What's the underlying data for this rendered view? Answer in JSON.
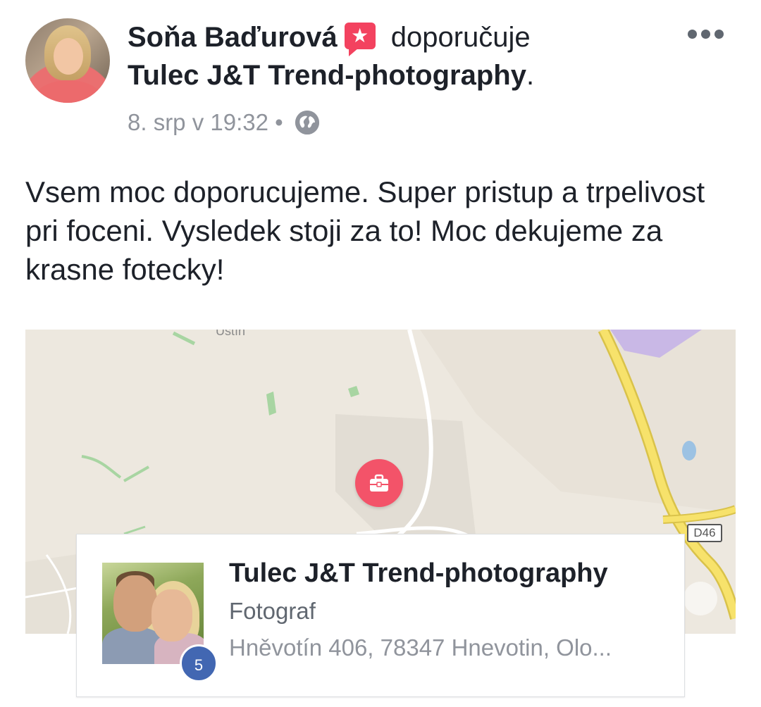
{
  "post": {
    "author": "Soňa Baďurová",
    "action": "doporučuje",
    "page_name": "Tulec J&T Trend-photography",
    "page_name_suffix": ".",
    "timestamp": "8. srp v 19:32",
    "separator": "•",
    "privacy_icon": "globe-icon",
    "recommend_badge_icon": "star-icon",
    "more_icon": "more-options-icon",
    "text": "Vsem moc doporucujeme. Super pristup a trpelivost pri foceni. Vysledek stoji za to! Moc dekujeme za krasne fotecky!"
  },
  "map": {
    "top_label": "Ústín",
    "road_label": "D46",
    "pin_icon": "briefcase-icon",
    "colors": {
      "land": "#ede8df",
      "road": "#f7e26b",
      "road_edge": "#d9c24a",
      "water": "#9cc2e3",
      "green": "#a8d5a2",
      "pin": "#f35369"
    }
  },
  "place": {
    "name": "Tulec J&T Trend-photography",
    "category": "Fotograf",
    "address": "Hněvotín 406, 78347 Hnevotin, Olo...",
    "rating": "5",
    "rating_color": "#4267b2"
  },
  "colors": {
    "text": "#1d2129",
    "meta": "#90949c",
    "badge": "#f3425f"
  }
}
